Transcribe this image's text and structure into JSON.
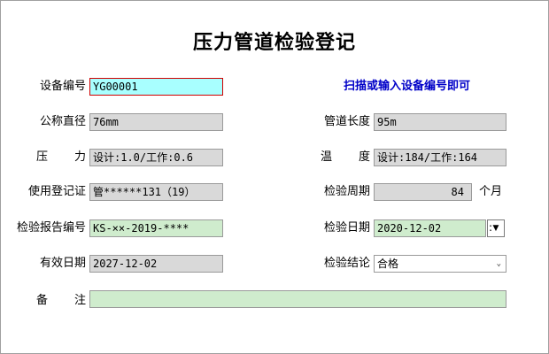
{
  "title": "压力管道检验登记",
  "hint": "扫描或输入设备编号即可",
  "fields": {
    "device_no": {
      "label": "设备编号",
      "value": "YG00001"
    },
    "nominal_diameter": {
      "label": "公称直径",
      "value": "76mm"
    },
    "pressure": {
      "label_a": "压",
      "label_b": "力",
      "value": "设计:1.0/工作:0.6"
    },
    "use_registration": {
      "label": "使用登记证",
      "value": "管******131（19）"
    },
    "report_no": {
      "label": "检验报告编号",
      "value": "KS-××-2019-****"
    },
    "valid_date": {
      "label": "有效日期",
      "value": "2027-12-02"
    },
    "remarks": {
      "label_a": "备",
      "label_b": "注",
      "value": ""
    },
    "pipe_length": {
      "label": "管道长度",
      "value": "95m"
    },
    "temperature": {
      "label_a": "温",
      "label_b": "度",
      "value": "设计:184/工作:164"
    },
    "inspection_cycle": {
      "label": "检验周期",
      "value": "84",
      "unit": "个月"
    },
    "inspection_date": {
      "label": "检验日期",
      "value": "2020-12-02"
    },
    "conclusion": {
      "label": "检验结论",
      "value": "合格"
    }
  },
  "colors": {
    "hint": "#0000c8",
    "highlight_field": "#a8ffff",
    "readonly_field": "#d9d9d9",
    "editable_field": "#cfeccd",
    "focus_border": "#d00000"
  }
}
